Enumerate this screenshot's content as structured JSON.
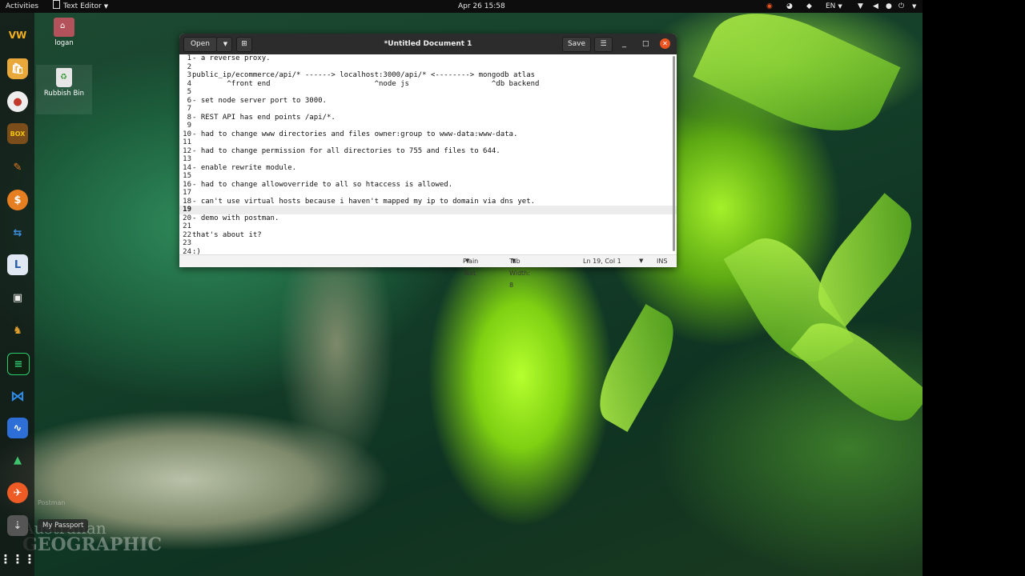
{
  "topbar": {
    "activities": "Activities",
    "app_menu": "Text Editor",
    "clock": "Apr 26  15:58",
    "language": "EN"
  },
  "desktop": {
    "home_label": "logan",
    "trash_label": "Rubbish Bin",
    "dock_tooltip": "My Passport",
    "dock_tooltip_faded": "Postman",
    "watermark_line1": "Australian",
    "watermark_line2": "GEOGRAPHIC"
  },
  "window": {
    "open_label": "Open",
    "title": "*Untitled Document 1",
    "save_label": "Save"
  },
  "editor": {
    "current_line": 19,
    "lines": [
      {
        "n": "1",
        "text": "- a reverse proxy."
      },
      {
        "n": "2",
        "text": ""
      },
      {
        "n": "3",
        "text": "public_ip/ecommerce/api/* ------> localhost:3000/api/* <--------> mongodb atlas"
      },
      {
        "n": "4",
        "text": "\t^front end\t\t\t  ^node js\t\t     ^db backend"
      },
      {
        "n": "5",
        "text": ""
      },
      {
        "n": "6",
        "text": "- set node server port to 3000."
      },
      {
        "n": "7",
        "text": ""
      },
      {
        "n": "8",
        "text": "- REST API has end points /api/*."
      },
      {
        "n": "9",
        "text": ""
      },
      {
        "n": "10",
        "text": "- had to change www directories and files owner:group to www-data:www-data."
      },
      {
        "n": "11",
        "text": ""
      },
      {
        "n": "12",
        "text": "- had to change permission for all directories to 755 and files to 644."
      },
      {
        "n": "13",
        "text": ""
      },
      {
        "n": "14",
        "text": "- enable rewrite module."
      },
      {
        "n": "15",
        "text": ""
      },
      {
        "n": "16",
        "text": "- had to change allowoverride to all so htaccess is allowed."
      },
      {
        "n": "17",
        "text": ""
      },
      {
        "n": "18",
        "text": "- can't use virtual hosts because i haven't mapped my ip to domain via dns yet."
      },
      {
        "n": "19",
        "text": ""
      },
      {
        "n": "20",
        "text": "- demo with postman."
      },
      {
        "n": "21",
        "text": ""
      },
      {
        "n": "22",
        "text": "that's about it?"
      },
      {
        "n": "23",
        "text": ""
      },
      {
        "n": "24",
        "text": ":)"
      }
    ]
  },
  "statusbar": {
    "language": "Plain Text",
    "tab_width": "Tab Width: 8",
    "position": "Ln 19, Col 1",
    "mode": "INS"
  },
  "colors": {
    "topbar": "#0d0d0d",
    "headerbar": "#2c2c2c",
    "close_button": "#e95420",
    "current_line": "#ececec"
  }
}
